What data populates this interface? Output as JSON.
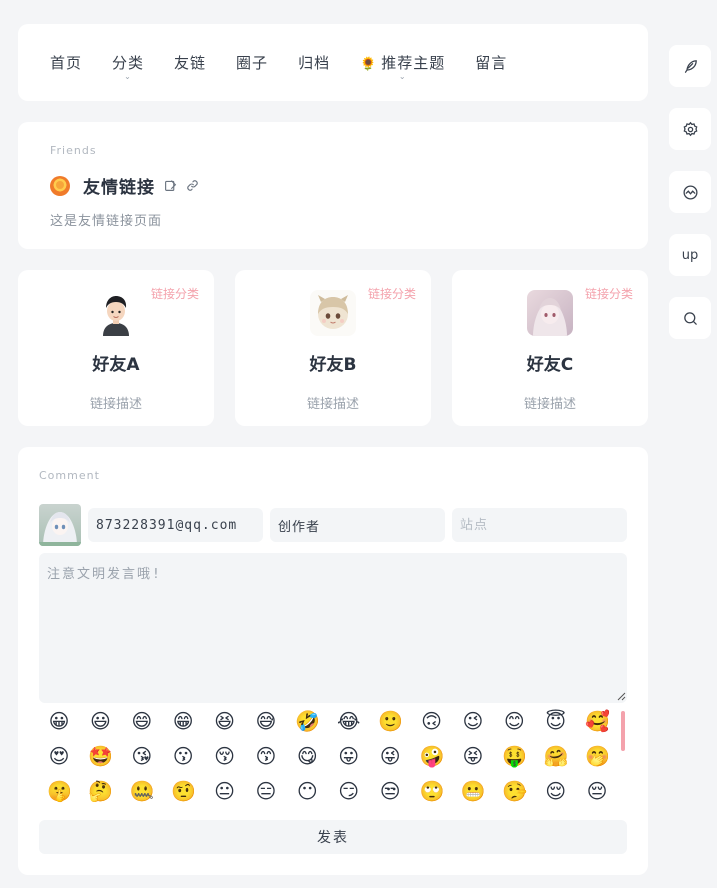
{
  "nav": {
    "items": [
      {
        "label": "首页"
      },
      {
        "label": "分类",
        "has_dropdown": true
      },
      {
        "label": "友链"
      },
      {
        "label": "圈子"
      },
      {
        "label": "归档"
      },
      {
        "label": "推荐主题",
        "icon": "sunflower-icon",
        "has_dropdown": true
      },
      {
        "label": "留言"
      }
    ]
  },
  "side_buttons": {
    "up_label": "up"
  },
  "friends": {
    "eyebrow": "Friends",
    "title": "友情链接",
    "subtitle": "这是友情链接页面"
  },
  "links": [
    {
      "name": "好友A",
      "desc": "链接描述",
      "tag": "链接分类"
    },
    {
      "name": "好友B",
      "desc": "链接描述",
      "tag": "链接分类"
    },
    {
      "name": "好友C",
      "desc": "链接描述",
      "tag": "链接分类"
    }
  ],
  "comment": {
    "eyebrow": "Comment",
    "email_value": "873228391@qq.com",
    "nick_value": "创作者",
    "site_placeholder": "站点",
    "textarea_placeholder": "注意文明发言哦!",
    "submit_label": "发表",
    "emojis": [
      "😀",
      "😃",
      "😄",
      "😁",
      "😆",
      "😅",
      "🤣",
      "😂",
      "🙂",
      "🙃",
      "😉",
      "😊",
      "😇",
      "🥰",
      "😍",
      "🤩",
      "😘",
      "😗",
      "😚",
      "😙",
      "😋",
      "😛",
      "😜",
      "🤪",
      "😝",
      "🤑",
      "🤗",
      "🤭",
      "🤫",
      "🤔",
      "🤐",
      "🤨",
      "😐",
      "😑",
      "😶",
      "😏",
      "😒",
      "🙄",
      "😬",
      "🤥",
      "😌",
      "😔"
    ]
  },
  "colors": {
    "accent_pink": "#f4a2ac",
    "background": "#f4f5f7",
    "card": "#ffffff"
  }
}
